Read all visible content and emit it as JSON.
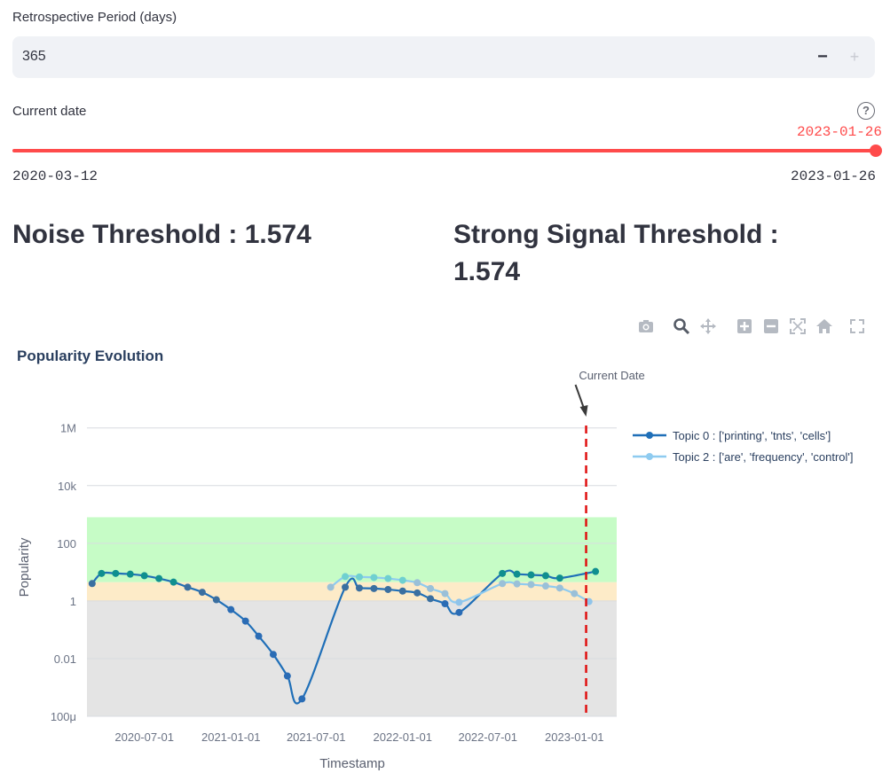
{
  "retrospective": {
    "label": "Retrospective Period (days)",
    "value": "365",
    "minus": "−",
    "plus": "+"
  },
  "current_date": {
    "label": "Current date",
    "help": "?",
    "selected": "2023-01-26",
    "min": "2020-03-12",
    "max": "2023-01-26",
    "position": 1.0
  },
  "thresholds": {
    "noise": "Noise Threshold : 1.574",
    "strong_line1": "Strong Signal Threshold :",
    "strong_line2": "1.574"
  },
  "modebar": [
    "camera-icon",
    "zoom-icon",
    "pan-icon",
    "zoom-in-icon",
    "zoom-out-icon",
    "autoscale-icon",
    "reset-axes-icon",
    "fullscreen-icon"
  ],
  "colors": {
    "accent": "#ff4b4b",
    "topic0": "#1f6fb8",
    "topic2": "#8ecbf0",
    "strong_zone": "#c6fcc6",
    "weak_zone": "#fdebc8",
    "noise_zone": "#e4e4e4",
    "current_line": "#e01010"
  },
  "chart_data": {
    "type": "line",
    "title": "Popularity Evolution",
    "xlabel": "Timestamp",
    "ylabel": "Popularity",
    "y_scale": "log",
    "ylim": [
      0.0001,
      5000000
    ],
    "xlim": [
      "2020-03-01",
      "2023-04-01"
    ],
    "x_ticks": [
      "2020-07-01",
      "2021-01-01",
      "2021-07-01",
      "2022-01-01",
      "2022-07-01",
      "2023-01-01"
    ],
    "y_ticks": [
      {
        "value": 1000000,
        "label": "1M"
      },
      {
        "value": 10000,
        "label": "10k"
      },
      {
        "value": 100,
        "label": "100"
      },
      {
        "value": 1,
        "label": "1"
      },
      {
        "value": 0.01,
        "label": "0.01"
      },
      {
        "value": 0.0001,
        "label": "100μ"
      }
    ],
    "zones": [
      {
        "name": "noise",
        "from": 0.0001,
        "to": 1
      },
      {
        "name": "weak",
        "from": 1,
        "to": 4.5
      },
      {
        "name": "strong",
        "from": 4.5,
        "to": 800
      }
    ],
    "current_date": {
      "x": "2023-01-26",
      "label": "Current Date"
    },
    "legend": "top-right",
    "series": [
      {
        "name": "Topic 0 : ['printing', 'tnts', 'cells']",
        "points": [
          [
            "2020-03-12",
            4.0
          ],
          [
            "2020-04-01",
            9.0
          ],
          [
            "2020-05-01",
            9.0
          ],
          [
            "2020-06-01",
            8.5
          ],
          [
            "2020-07-01",
            7.5
          ],
          [
            "2020-08-01",
            6.0
          ],
          [
            "2020-09-01",
            4.5
          ],
          [
            "2020-10-01",
            3.0
          ],
          [
            "2020-11-01",
            2.0
          ],
          [
            "2020-12-01",
            1.1
          ],
          [
            "2021-01-01",
            0.5
          ],
          [
            "2021-02-01",
            0.2
          ],
          [
            "2021-03-01",
            0.06
          ],
          [
            "2021-04-01",
            0.014
          ],
          [
            "2021-05-01",
            0.0025
          ],
          [
            "2021-06-01",
            0.0004
          ],
          [
            "2021-09-01",
            3.0
          ],
          [
            "2021-10-01",
            2.8
          ],
          [
            "2021-11-01",
            2.7
          ],
          [
            "2021-12-01",
            2.5
          ],
          [
            "2022-01-01",
            2.2
          ],
          [
            "2022-02-01",
            1.9
          ],
          [
            "2022-03-01",
            1.2
          ],
          [
            "2022-04-01",
            0.8
          ],
          [
            "2022-05-01",
            0.4
          ],
          [
            "2022-08-01",
            9.0
          ],
          [
            "2022-09-01",
            8.5
          ],
          [
            "2022-10-01",
            8.0
          ],
          [
            "2022-11-01",
            7.5
          ],
          [
            "2022-12-01",
            6.2
          ],
          [
            "2023-02-15",
            10.5
          ]
        ]
      },
      {
        "name": "Topic 2 : ['are', 'frequency', 'control']",
        "points": [
          [
            "2021-08-01",
            3.0
          ],
          [
            "2021-09-01",
            7.0
          ],
          [
            "2021-10-01",
            6.8
          ],
          [
            "2021-11-01",
            6.5
          ],
          [
            "2021-12-01",
            6.0
          ],
          [
            "2022-01-01",
            5.2
          ],
          [
            "2022-02-01",
            4.3
          ],
          [
            "2022-03-01",
            2.7
          ],
          [
            "2022-04-01",
            1.8
          ],
          [
            "2022-05-01",
            0.9
          ],
          [
            "2022-08-01",
            4.0
          ],
          [
            "2022-09-01",
            3.9
          ],
          [
            "2022-10-01",
            3.7
          ],
          [
            "2022-11-01",
            3.3
          ],
          [
            "2022-12-01",
            2.8
          ],
          [
            "2023-01-01",
            1.8
          ],
          [
            "2023-02-01",
            0.95
          ]
        ]
      }
    ]
  }
}
